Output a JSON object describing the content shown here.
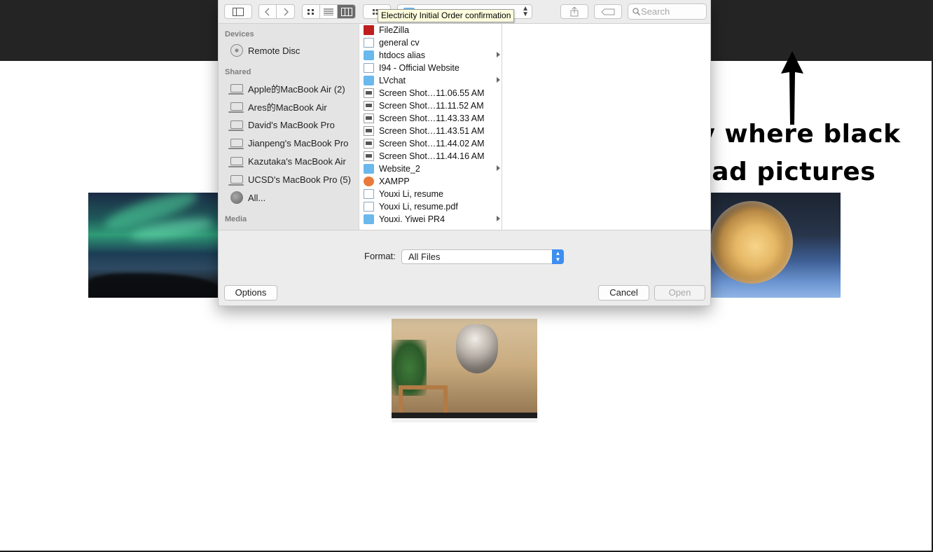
{
  "annotation": {
    "line1": "Click any where black",
    "line2": "to upload pictures"
  },
  "dialog": {
    "tooltip": "Electricity Initial Order confirmation",
    "search_placeholder": "Search",
    "sidebar": {
      "devices_heading": "Devices",
      "shared_heading": "Shared",
      "media_heading": "Media",
      "devices": [
        {
          "label": "Remote Disc",
          "icon": "disc-icon"
        }
      ],
      "shared": [
        {
          "label": "Apple的MacBook Air (2)",
          "icon": "laptop-icon"
        },
        {
          "label": "Ares的MacBook Air",
          "icon": "laptop-icon"
        },
        {
          "label": "David's MacBook Pro",
          "icon": "laptop-icon"
        },
        {
          "label": "Jianpeng's MacBook Pro",
          "icon": "laptop-icon"
        },
        {
          "label": "Kazutaka's MacBook Air",
          "icon": "laptop-icon"
        },
        {
          "label": "UCSD's MacBook Pro (5)",
          "icon": "laptop-icon"
        },
        {
          "label": "All...",
          "icon": "network-globe-icon"
        }
      ]
    },
    "files": [
      {
        "name": "FileZilla",
        "type": "app",
        "icon": "filezilla-icon"
      },
      {
        "name": "general cv",
        "type": "doc",
        "icon": "document-icon"
      },
      {
        "name": "htdocs alias",
        "type": "folder",
        "icon": "folder-icon",
        "has_children": true
      },
      {
        "name": "I94 - Official Website",
        "type": "doc",
        "icon": "document-icon"
      },
      {
        "name": "LVchat",
        "type": "folder",
        "icon": "folder-icon",
        "has_children": true
      },
      {
        "name": "Screen Shot…11.06.55 AM",
        "type": "image",
        "icon": "screenshot-icon"
      },
      {
        "name": "Screen Shot…11.11.52 AM",
        "type": "image",
        "icon": "screenshot-icon"
      },
      {
        "name": "Screen Shot…11.43.33 AM",
        "type": "image",
        "icon": "screenshot-icon"
      },
      {
        "name": "Screen Shot…11.43.51 AM",
        "type": "image",
        "icon": "screenshot-icon"
      },
      {
        "name": "Screen Shot…11.44.02 AM",
        "type": "image",
        "icon": "screenshot-icon"
      },
      {
        "name": "Screen Shot…11.44.16 AM",
        "type": "image",
        "icon": "screenshot-icon"
      },
      {
        "name": "Website_2",
        "type": "folder",
        "icon": "folder-icon",
        "has_children": true
      },
      {
        "name": "XAMPP",
        "type": "app",
        "icon": "xampp-icon"
      },
      {
        "name": "Youxi Li, resume",
        "type": "doc",
        "icon": "document-icon"
      },
      {
        "name": "Youxi Li, resume.pdf",
        "type": "doc",
        "icon": "pdf-icon"
      },
      {
        "name": "Youxi. Yiwei PR4",
        "type": "folder",
        "icon": "folder-icon",
        "has_children": true
      }
    ],
    "format_label": "Format:",
    "format_value": "All Files",
    "options_label": "Options",
    "cancel_label": "Cancel",
    "open_label": "Open"
  },
  "colors": {
    "header_black": "#242424",
    "accent_blue": "#3d8ef0"
  }
}
